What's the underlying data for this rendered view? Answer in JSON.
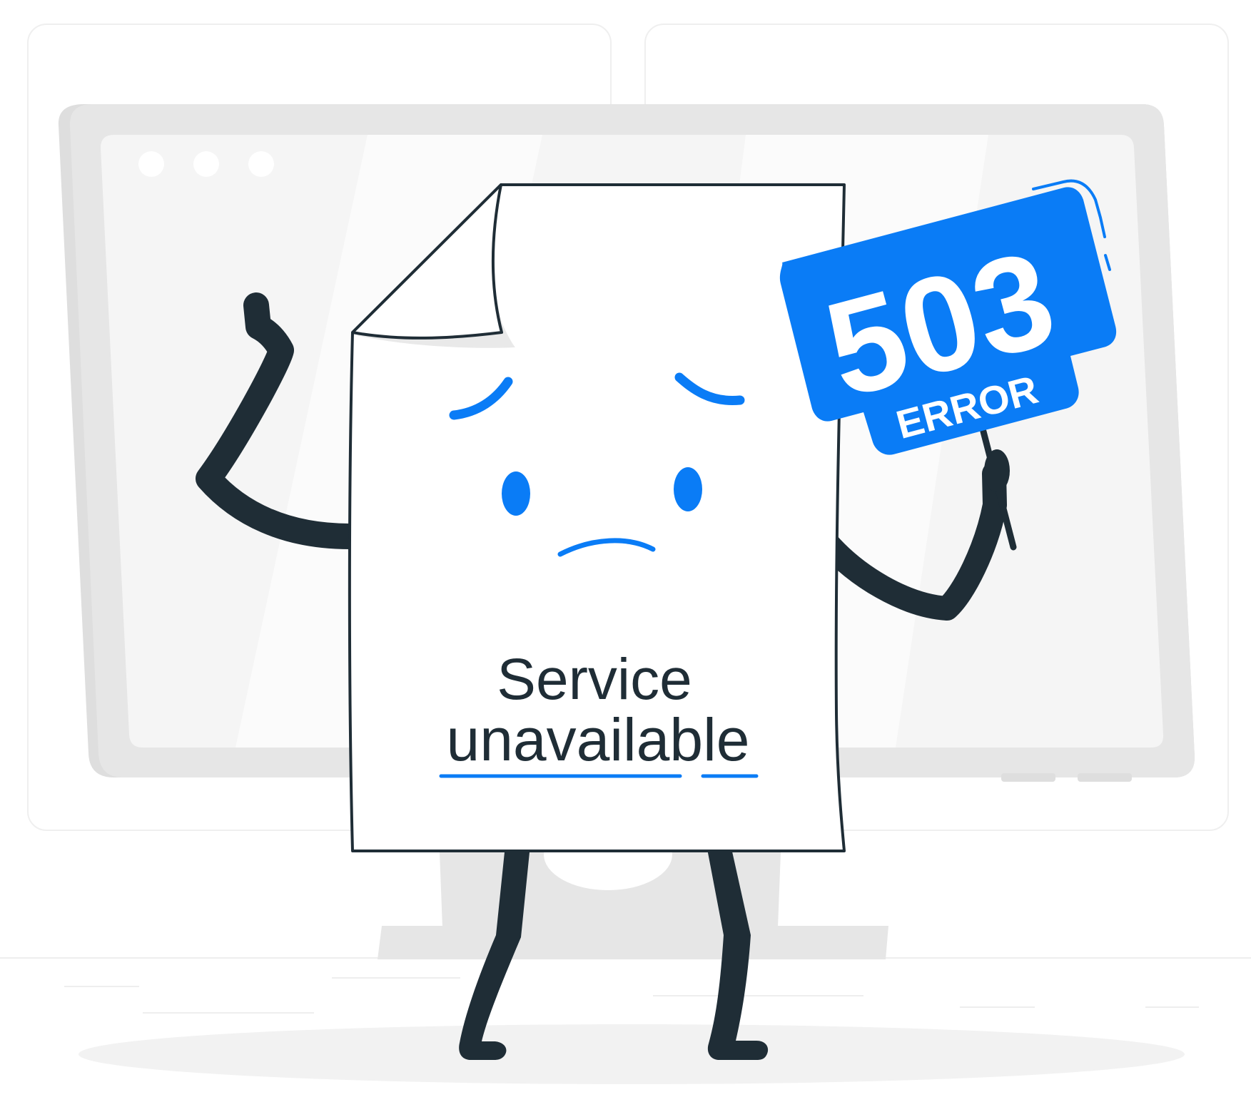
{
  "illustration": {
    "browser_window": {
      "window_dots": [
        "dot-1",
        "dot-2",
        "dot-3"
      ]
    },
    "document_character": {
      "caption_line1": "Service",
      "caption_line2": "unavailable",
      "expression": "sad"
    },
    "sign": {
      "code": "503",
      "label": "ERROR"
    }
  },
  "colors": {
    "accent": "#0a7cf6",
    "outline": "#1f2d36",
    "page_bg": "#ffffff",
    "monitor_frame": "#e6e6e6",
    "monitor_screen": "#f5f5f5",
    "panel_border": "#efefef"
  },
  "icons": {
    "window_dots": "circle-dot-icon",
    "arm_raised": "raised-arm-icon",
    "face": "sad-face-icon"
  }
}
